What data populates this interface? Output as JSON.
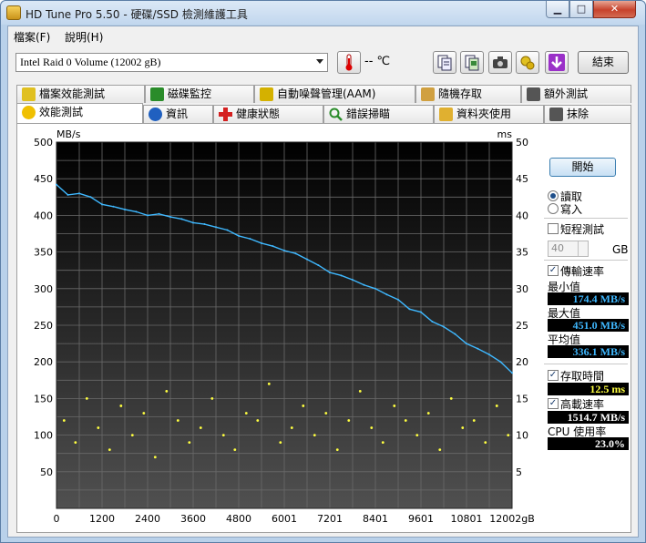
{
  "window": {
    "title": "HD Tune Pro 5.50 - 硬碟/SSD 檢測維護工具",
    "buttons": {
      "minimize": "▁",
      "maximize": "□",
      "close": "✕"
    }
  },
  "menu": [
    {
      "label": "檔案(F)"
    },
    {
      "label": "說明(H)"
    }
  ],
  "toolbar": {
    "drive": "Intel   Raid 0 Volume (12002 gB)",
    "temperature": "-- ℃",
    "exit_label": "結束",
    "icons": [
      "thermometer-icon",
      "copy-text-icon",
      "copy-screenshot-icon",
      "camera-icon",
      "options-icon",
      "download-icon"
    ]
  },
  "tabs_top": [
    {
      "label": "檔案效能測試",
      "icon": "file-benchmark-icon",
      "color": "#e0c020"
    },
    {
      "label": "磁碟監控",
      "icon": "disk-monitor-icon",
      "color": "#2a8c2a"
    },
    {
      "label": "自動噪聲管理(AAM)",
      "icon": "speaker-icon",
      "color": "#d4b100"
    },
    {
      "label": "隨機存取",
      "icon": "random-access-icon",
      "color": "#d0a040"
    },
    {
      "label": "額外測試",
      "icon": "extra-tests-icon",
      "color": "#555555"
    }
  ],
  "tabs_bottom": [
    {
      "label": "效能測試",
      "icon": "benchmark-bulb-icon",
      "color": "#f0c000",
      "active": true
    },
    {
      "label": "資訊",
      "icon": "info-icon",
      "color": "#2060c0"
    },
    {
      "label": "健康狀態",
      "icon": "health-cross-icon",
      "color": "#d42020"
    },
    {
      "label": "錯誤掃瞄",
      "icon": "error-scan-icon",
      "color": "#2a8c2a"
    },
    {
      "label": "資料夾使用",
      "icon": "folder-icon",
      "color": "#e0b030"
    },
    {
      "label": "抹除",
      "icon": "trash-icon",
      "color": "#555555"
    }
  ],
  "controls": {
    "start_label": "開始",
    "read_label": "讀取",
    "write_label": "寫入",
    "short_test_label": "短程測試",
    "short_test_size": "40",
    "short_test_unit": "GB",
    "transfer_rate_label": "傳輸速率",
    "min_label": "最小值",
    "min_value": "174.4 MB/s",
    "max_label": "最大值",
    "max_value": "451.0 MB/s",
    "avg_label": "平均值",
    "avg_value": "336.1 MB/s",
    "access_time_label": "存取時間",
    "access_time_value": "12.5 ms",
    "burst_rate_label": "高載速率",
    "burst_rate_value": "1514.7 MB/s",
    "cpu_label": "CPU 使用率",
    "cpu_value": "23.0%",
    "colors": {
      "rate": "#3fb8ff",
      "access": "#ffff40",
      "cpu": "#ffffff"
    }
  },
  "chart_data": {
    "type": "line",
    "left_unit": "MB/s",
    "right_unit": "ms",
    "y_left_ticks": [
      "500",
      "450",
      "400",
      "350",
      "300",
      "250",
      "200",
      "150",
      "100",
      "50"
    ],
    "y_right_ticks": [
      "50",
      "45",
      "40",
      "35",
      "30",
      "25",
      "20",
      "15",
      "10",
      "5"
    ],
    "x_ticks": [
      "0",
      "1200",
      "2400",
      "3600",
      "4800",
      "6001",
      "7201",
      "8401",
      "9601",
      "10801",
      "12002gB"
    ],
    "x_range": [
      0,
      12002
    ],
    "y_left_range": [
      0,
      500
    ],
    "y_right_range": [
      0,
      50
    ],
    "grid": true,
    "series": [
      {
        "name": "傳輸速率",
        "color": "#3fb8ff",
        "x": [
          0,
          300,
          600,
          900,
          1200,
          1500,
          1800,
          2100,
          2400,
          2700,
          3000,
          3300,
          3600,
          3900,
          4200,
          4500,
          4800,
          5100,
          5400,
          5700,
          6000,
          6300,
          6600,
          6900,
          7200,
          7500,
          7800,
          8100,
          8400,
          8700,
          9000,
          9300,
          9600,
          9900,
          10200,
          10500,
          10800,
          11100,
          11400,
          11700,
          12002
        ],
        "y": [
          442,
          428,
          430,
          425,
          415,
          412,
          408,
          405,
          400,
          402,
          398,
          395,
          390,
          388,
          384,
          380,
          372,
          368,
          362,
          358,
          352,
          348,
          340,
          332,
          322,
          318,
          312,
          305,
          300,
          292,
          285,
          272,
          268,
          255,
          248,
          238,
          225,
          218,
          210,
          200,
          185
        ]
      },
      {
        "name": "存取時間",
        "color": "#ffff40",
        "type": "scatter",
        "x": [
          200,
          500,
          800,
          1100,
          1400,
          1700,
          2000,
          2300,
          2600,
          2900,
          3200,
          3500,
          3800,
          4100,
          4400,
          4700,
          5000,
          5300,
          5600,
          5900,
          6200,
          6500,
          6800,
          7100,
          7400,
          7700,
          8000,
          8300,
          8600,
          8900,
          9200,
          9500,
          9800,
          10100,
          10400,
          10700,
          11000,
          11300,
          11600,
          11900
        ],
        "y": [
          12,
          9,
          15,
          11,
          8,
          14,
          10,
          13,
          7,
          16,
          12,
          9,
          11,
          15,
          10,
          8,
          13,
          12,
          17,
          9,
          11,
          14,
          10,
          13,
          8,
          12,
          16,
          11,
          9,
          14,
          12,
          10,
          13,
          8,
          15,
          11,
          12,
          9,
          14,
          10
        ]
      }
    ]
  }
}
